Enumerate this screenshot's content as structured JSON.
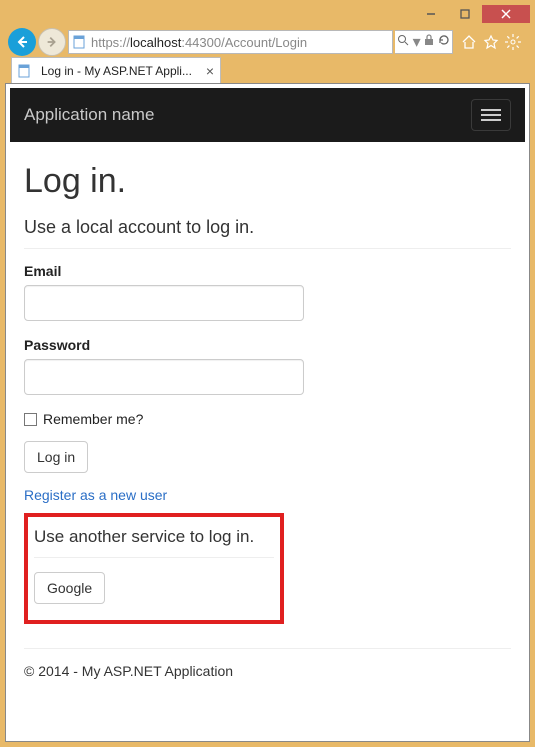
{
  "window": {
    "tab_title": "Log in - My ASP.NET Appli...",
    "url_prefix": "https://",
    "url_host": "localhost",
    "url_port": ":44300",
    "url_path": "/Account/Login"
  },
  "navbar": {
    "brand": "Application name"
  },
  "page": {
    "heading": "Log in.",
    "local_subhead": "Use a local account to log in.",
    "email_label": "Email",
    "password_label": "Password",
    "remember_label": "Remember me?",
    "login_button": "Log in",
    "register_link": "Register as a new user",
    "external_subhead": "Use another service to log in.",
    "google_button": "Google"
  },
  "footer": {
    "text": "© 2014 - My ASP.NET Application"
  }
}
